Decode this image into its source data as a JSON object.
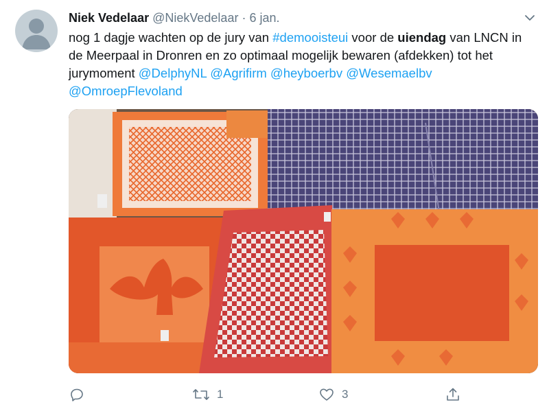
{
  "tweet": {
    "author_name": "Niek Vedelaar",
    "handle": "@NiekVedelaar",
    "separator": "·",
    "date": "6 jan.",
    "text_parts": {
      "p1": "nog 1 dagje wachten op de jury van ",
      "hashtag": "#demooisteui",
      "p2": " voor de ",
      "bold": "uiendag",
      "p3": " van LNCN in de Meerpaal in Dronren en zo optimaal mogelijk bewaren (afdekken) tot het jurymoment ",
      "mention1": "@DelphyNL",
      "mention2": "@Agrifirm",
      "mention3": "@heyboerbv",
      "mention4": "@Wesemaelbv",
      "mention5": "@OmroepFlevoland"
    },
    "media_description": "photo",
    "actions": {
      "reply": {
        "icon": "reply-icon",
        "count": ""
      },
      "retweet": {
        "icon": "retweet-icon",
        "count": "1"
      },
      "like": {
        "icon": "heart-icon",
        "count": "3"
      },
      "share": {
        "icon": "share-icon",
        "count": ""
      }
    }
  },
  "colors": {
    "link": "#1da1f2",
    "secondary_text": "#657786",
    "avatar_bg": "#c4cfd6"
  }
}
